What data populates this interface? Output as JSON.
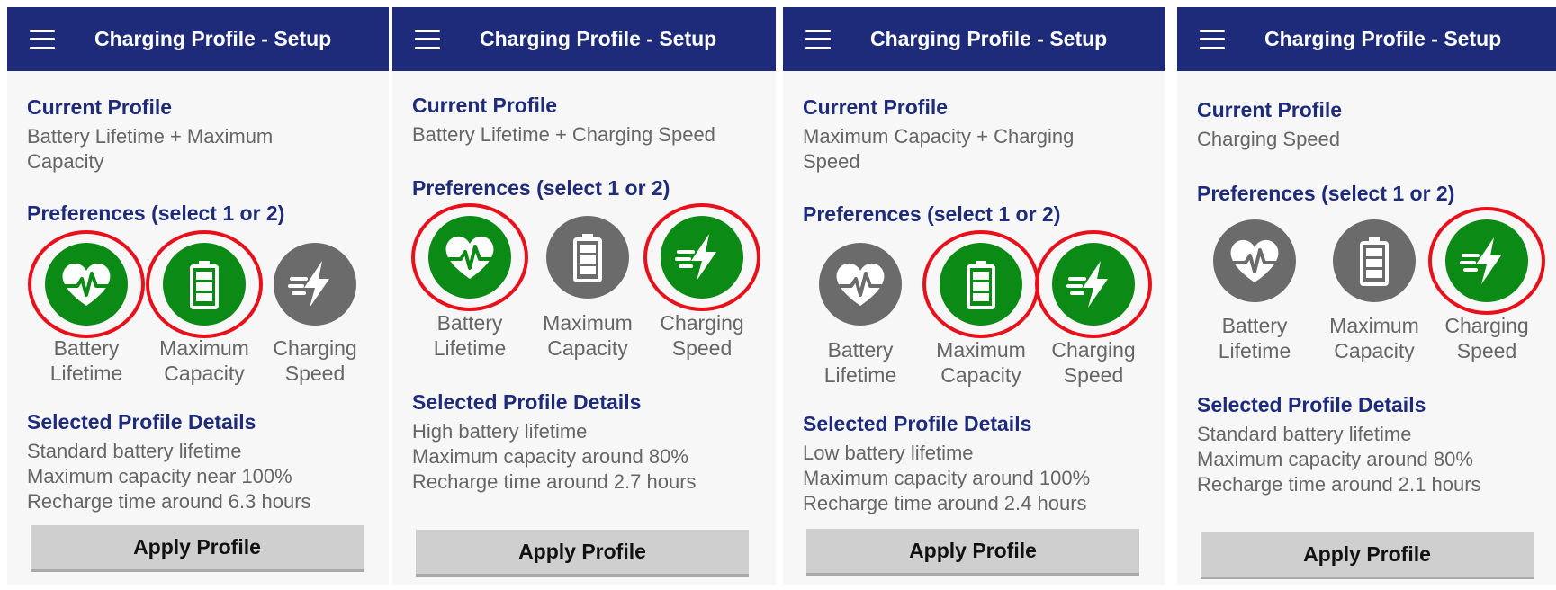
{
  "panels": [
    {
      "title": "Charging Profile - Setup",
      "current_profile_heading": "Current Profile",
      "current_profile_value": "Battery Lifetime + Maximum Capacity",
      "preferences_heading": "Preferences (select 1 or 2)",
      "preferences": [
        {
          "label_line1": "Battery",
          "label_line2": "Lifetime",
          "icon": "heart-pulse-icon",
          "selected": true
        },
        {
          "label_line1": "Maximum",
          "label_line2": "Capacity",
          "icon": "battery-icon",
          "selected": true
        },
        {
          "label_line1": "Charging",
          "label_line2": "Speed",
          "icon": "fast-charge-icon",
          "selected": false
        }
      ],
      "details_heading": "Selected Profile Details",
      "details": [
        "Standard battery lifetime",
        "Maximum capacity near 100%",
        "Recharge time around 6.3 hours"
      ],
      "apply_label": "Apply Profile"
    },
    {
      "title": "Charging Profile - Setup",
      "current_profile_heading": "Current Profile",
      "current_profile_value": "Battery Lifetime + Charging Speed",
      "preferences_heading": "Preferences (select 1 or 2)",
      "preferences": [
        {
          "label_line1": "Battery",
          "label_line2": "Lifetime",
          "icon": "heart-pulse-icon",
          "selected": true
        },
        {
          "label_line1": "Maximum",
          "label_line2": "Capacity",
          "icon": "battery-icon",
          "selected": false
        },
        {
          "label_line1": "Charging",
          "label_line2": "Speed",
          "icon": "fast-charge-icon",
          "selected": true
        }
      ],
      "details_heading": "Selected Profile Details",
      "details": [
        "High battery lifetime",
        "Maximum capacity around 80%",
        "Recharge time around 2.7 hours"
      ],
      "apply_label": "Apply Profile"
    },
    {
      "title": "Charging Profile - Setup",
      "current_profile_heading": "Current Profile",
      "current_profile_value": "Maximum Capacity + Charging Speed",
      "preferences_heading": "Preferences (select 1 or 2)",
      "preferences": [
        {
          "label_line1": "Battery",
          "label_line2": "Lifetime",
          "icon": "heart-pulse-icon",
          "selected": false
        },
        {
          "label_line1": "Maximum",
          "label_line2": "Capacity",
          "icon": "battery-icon",
          "selected": true
        },
        {
          "label_line1": "Charging",
          "label_line2": "Speed",
          "icon": "fast-charge-icon",
          "selected": true
        }
      ],
      "details_heading": "Selected Profile Details",
      "details": [
        "Low battery lifetime",
        "Maximum capacity around 100%",
        "Recharge time around 2.4 hours"
      ],
      "apply_label": "Apply Profile"
    },
    {
      "title": "Charging Profile - Setup",
      "current_profile_heading": "Current Profile",
      "current_profile_value": "Charging Speed",
      "preferences_heading": "Preferences (select 1 or 2)",
      "preferences": [
        {
          "label_line1": "Battery",
          "label_line2": "Lifetime",
          "icon": "heart-pulse-icon",
          "selected": false
        },
        {
          "label_line1": "Maximum",
          "label_line2": "Capacity",
          "icon": "battery-icon",
          "selected": false
        },
        {
          "label_line1": "Charging",
          "label_line2": "Speed",
          "icon": "fast-charge-icon",
          "selected": true
        }
      ],
      "details_heading": "Selected Profile Details",
      "details": [
        "Standard battery lifetime",
        "Maximum capacity around 80%",
        "Recharge time around 2.1 hours"
      ],
      "apply_label": "Apply Profile"
    }
  ],
  "colors": {
    "app_bar": "#1d2b7a",
    "heading": "#1d2b7a",
    "selected_icon": "#0b8a15",
    "unselected_icon": "#6b6b6b",
    "selection_ring": "#e8101a",
    "button": "#cfcfcf"
  }
}
